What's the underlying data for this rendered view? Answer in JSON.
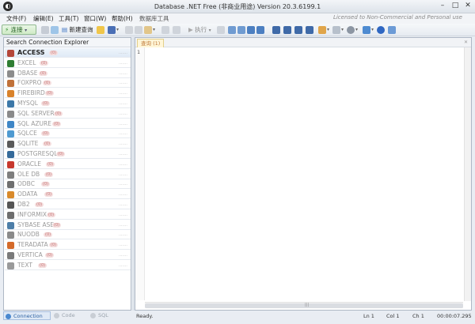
{
  "window": {
    "title": "Database .NET Free (非商业用途)   Version 20.3.6199.1",
    "app_icon": "database-net-logo",
    "controls": [
      "minimize",
      "maximize",
      "close"
    ]
  },
  "menu": {
    "items": [
      "文件(F)",
      "编辑(E)",
      "工具(T)",
      "窗口(W)",
      "帮助(H)",
      "数据库工具"
    ],
    "license_text": "Licensed to Non-Commercial and Personal use"
  },
  "toolbar": {
    "connect_label": "连接",
    "new_query_label": "新建查询",
    "execute_label": "执行"
  },
  "explorer": {
    "title": "Search Connection Explorer",
    "items": [
      {
        "label": "ACCESS",
        "count": "(0)",
        "color": "#b5473a"
      },
      {
        "label": "EXCEL",
        "count": "(0)",
        "color": "#2e7d32"
      },
      {
        "label": "DBASE",
        "count": "(0)",
        "color": "#8c8c8c"
      },
      {
        "label": "FOXPRO",
        "count": "(0)",
        "color": "#c0713a"
      },
      {
        "label": "FIREBIRD",
        "count": "(0)",
        "color": "#d9822b"
      },
      {
        "label": "MYSQL",
        "count": "(0)",
        "color": "#3c78a8"
      },
      {
        "label": "SQL SERVER",
        "count": "(0)",
        "color": "#8a8a8a"
      },
      {
        "label": "SQL AZURE",
        "count": "(0)",
        "color": "#3f86c6"
      },
      {
        "label": "SQLCE",
        "count": "(0)",
        "color": "#4f9ad1"
      },
      {
        "label": "SQLITE",
        "count": "(0)",
        "color": "#5a5a5a"
      },
      {
        "label": "POSTGRESQL",
        "count": "(0)",
        "color": "#356a9a"
      },
      {
        "label": "ORACLE",
        "count": "(0)",
        "color": "#c7382e"
      },
      {
        "label": "OLE DB",
        "count": "(0)",
        "color": "#7e7e7e"
      },
      {
        "label": "ODBC",
        "count": "(0)",
        "color": "#6f6f6f"
      },
      {
        "label": "ODATA",
        "count": "(0)",
        "color": "#d98a2b"
      },
      {
        "label": "DB2",
        "count": "(0)",
        "color": "#555555"
      },
      {
        "label": "INFORMIX",
        "count": "(0)",
        "color": "#6d6d6d"
      },
      {
        "label": "SYBASE ASE",
        "count": "(0)",
        "color": "#4d7ea8"
      },
      {
        "label": "NUODB",
        "count": "(0)",
        "color": "#8a8a8a"
      },
      {
        "label": "TERADATA",
        "count": "(0)",
        "color": "#d46a2a"
      },
      {
        "label": "VERTICA",
        "count": "(0)",
        "color": "#7a7a7a"
      },
      {
        "label": "TEXT",
        "count": "(0)",
        "color": "#9a9a9a"
      }
    ]
  },
  "editor": {
    "tab_label": "查询 (1)",
    "line_number": "1"
  },
  "bottom_tabs": [
    "Connection",
    "Code",
    "SQL"
  ],
  "status": {
    "state": "Ready.",
    "line": "Ln 1",
    "col": "Col 1",
    "ch": "Ch 1",
    "elapsed": "00:00:07.295"
  }
}
